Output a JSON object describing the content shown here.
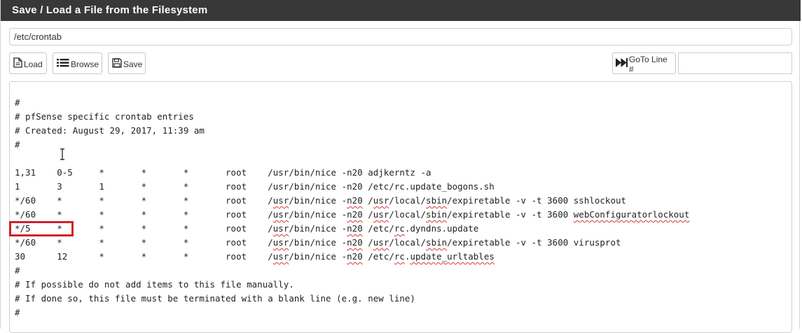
{
  "panel": {
    "title": "Save / Load a File from the Filesystem"
  },
  "file_path": {
    "value": "/etc/crontab",
    "placeholder": ""
  },
  "toolbar": {
    "load_label": "Load",
    "browse_label": "Browse",
    "save_label": "Save",
    "goto_label": "GoTo Line #",
    "goto_value": ""
  },
  "editor": {
    "lines": [
      "#",
      "# pfSense specific crontab entries",
      "# Created: August 29, 2017, 11:39 am",
      "#",
      "",
      "1,31    0-5     *       *       *       root    /usr/bin/nice -n20 adjkerntz -a",
      "1       3       1       *       *       root    /usr/bin/nice -n20 /etc/rc.update_bogons.sh",
      "*/60    *       *       *       *       root    /usr/bin/nice -n20 /usr/local/sbin/expiretable -v -t 3600 sshlockout",
      "*/60    *       *       *       *       root    /usr/bin/nice -n20 /usr/local/sbin/expiretable -v -t 3600 webConfiguratorlockout",
      "*/5     *       *       *       *       root    /usr/bin/nice -n20 /etc/rc.dyndns.update",
      "*/60    *       *       *       *       root    /usr/bin/nice -n20 /usr/local/sbin/expiretable -v -t 3600 virusprot",
      "30      12      *       *       *       root    /usr/bin/nice -n20 /etc/rc.update_urltables",
      "#",
      "# If possible do not add items to this file manually.",
      "# If done so, this file must be terminated with a blank line (e.g. new line)",
      "#"
    ]
  }
}
